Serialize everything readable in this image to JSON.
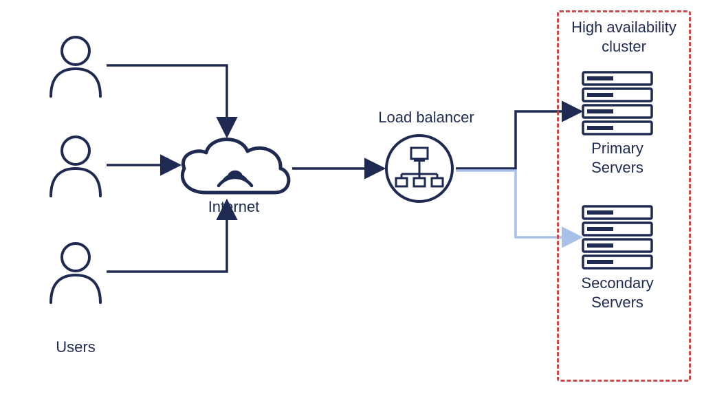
{
  "labels": {
    "users": "Users",
    "internet": "Internet",
    "load_balancer": "Load balancer",
    "cluster_title_line1": "High availability",
    "cluster_title_line2": "cluster",
    "primary_line1": "Primary",
    "primary_line2": "Servers",
    "secondary_line1": "Secondary",
    "secondary_line2": "Servers"
  },
  "colors": {
    "primary_stroke": "#1f2a52",
    "cluster_border": "#c94a4a",
    "failover_stroke": "#a9c0e8"
  },
  "diagram": {
    "nodes": [
      {
        "id": "users",
        "type": "user-group",
        "count": 3
      },
      {
        "id": "internet",
        "type": "cloud"
      },
      {
        "id": "load_balancer",
        "type": "load-balancer"
      },
      {
        "id": "primary_servers",
        "type": "server-stack",
        "group": "ha-cluster"
      },
      {
        "id": "secondary_servers",
        "type": "server-stack",
        "group": "ha-cluster"
      }
    ],
    "edges": [
      {
        "from": "users",
        "to": "internet",
        "style": "solid"
      },
      {
        "from": "internet",
        "to": "load_balancer",
        "style": "solid"
      },
      {
        "from": "load_balancer",
        "to": "primary_servers",
        "style": "solid"
      },
      {
        "from": "load_balancer",
        "to": "secondary_servers",
        "style": "failover"
      }
    ],
    "groups": [
      {
        "id": "ha-cluster",
        "title": "High availability cluster"
      }
    ]
  }
}
